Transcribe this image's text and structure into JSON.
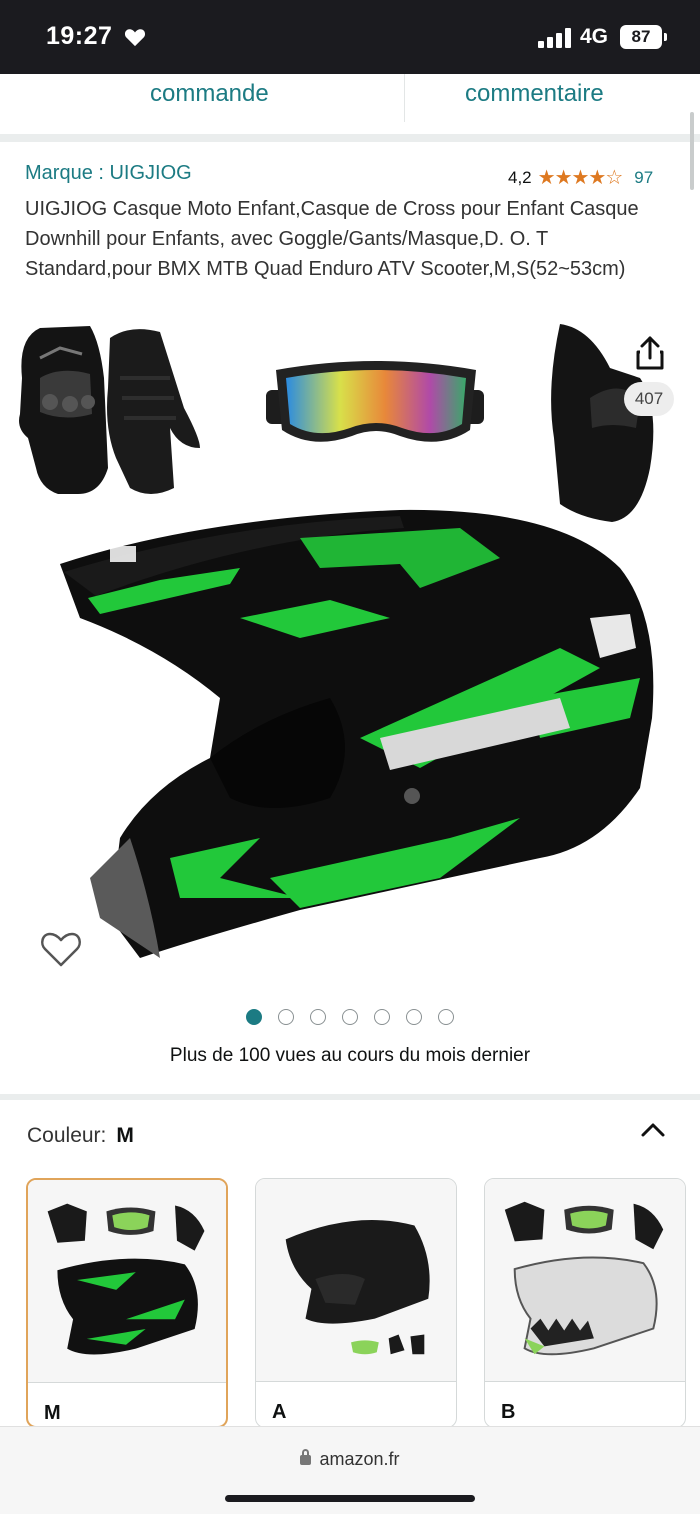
{
  "status_bar": {
    "time": "19:27",
    "network": "4G",
    "battery": "87"
  },
  "tabs": [
    {
      "label": "commande"
    },
    {
      "label": "commentaire"
    }
  ],
  "product": {
    "brand_link": "Marque : UIGJIOG",
    "rating_value": "4,2",
    "rating_stars": "★★★★☆",
    "rating_count": "97",
    "title": "UIGJIOG Casque Moto Enfant,Casque de Cross pour Enfant Casque Downhill pour Enfants, avec Goggle/Gants/Masque,D. O. T Standard,pour BMX MTB Quad Enduro ATV Scooter,M,S(52~53cm)"
  },
  "gallery": {
    "image_count": "407",
    "total_dots": 7,
    "active_dot": 0,
    "views_text": "Plus de 100 vues au cours du mois dernier"
  },
  "variation": {
    "label": "Couleur:",
    "selected": "M",
    "options": [
      {
        "label": "M",
        "selected": true
      },
      {
        "label": "A",
        "selected": false
      },
      {
        "label": "B",
        "selected": false
      }
    ]
  },
  "browser": {
    "url": "amazon.fr"
  },
  "colors": {
    "link": "#1c7b83",
    "star": "#de7921",
    "helmet_green": "#22c83a",
    "selected_border": "#e0a45a"
  }
}
